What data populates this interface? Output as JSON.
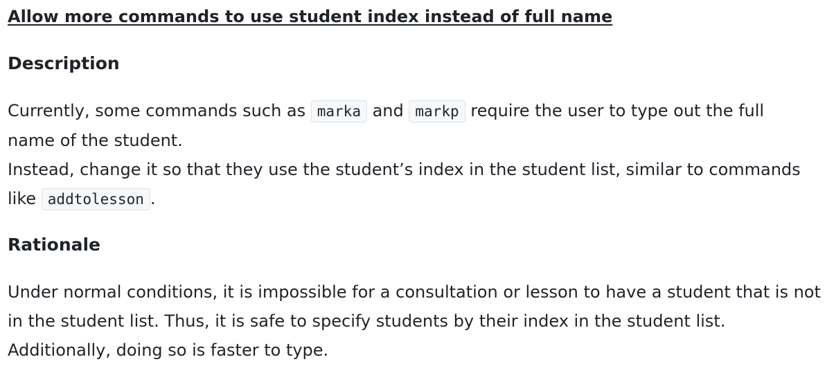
{
  "title": "Allow more commands to use student index instead of full name",
  "description": {
    "heading": "Description",
    "line1_before": "Currently, some commands such as ",
    "code_marka": "marka",
    "line1_and": " and ",
    "code_markp": "markp",
    "line1_after": " require the user to type out the full",
    "line2": "name of the student.",
    "line3": "Instead, change it so that they use the student’s index in the student list, similar to commands",
    "line4_before": "like ",
    "code_addtolesson": "addtolesson",
    "line4_after": "."
  },
  "rationale": {
    "heading": "Rationale",
    "line1": "Under normal conditions, it is impossible for a consultation or lesson to have a student that is not",
    "line2": "in the student list. Thus, it is safe to specify students by their index in the student list.",
    "line3": "Additionally, doing so is faster to type."
  }
}
